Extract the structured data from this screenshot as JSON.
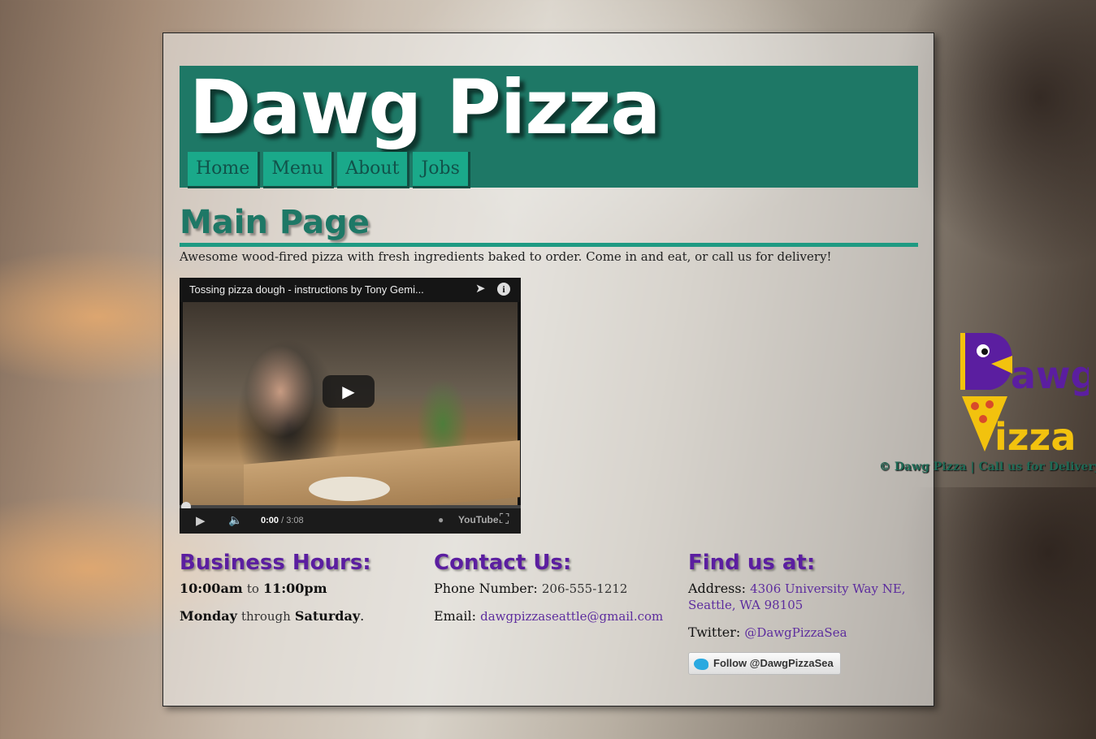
{
  "site": {
    "title": "Dawg Pizza"
  },
  "nav": {
    "items": [
      {
        "label": "Home"
      },
      {
        "label": "Menu"
      },
      {
        "label": "About"
      },
      {
        "label": "Jobs"
      }
    ]
  },
  "main": {
    "heading": "Main Page",
    "intro": "Awesome wood-fired pizza with fresh ingredients baked to order. Come in and eat, or call us for delivery!"
  },
  "video": {
    "title": "Tossing pizza dough - instructions by Tony Gemi...",
    "current_time": "0:00",
    "duration": "/ 3:08",
    "provider": "YouTube"
  },
  "hours": {
    "heading": "Business Hours:",
    "open": "10:00am",
    "to": "to",
    "close": "11:00pm",
    "day_start": "Monday",
    "through": "through",
    "day_end": "Saturday",
    "period": "."
  },
  "contact": {
    "heading": "Contact Us:",
    "phone_label": "Phone Number:",
    "phone": "206-555-1212",
    "email_label": "Email:",
    "email": "dawgpizzaseattle@gmail.com"
  },
  "find": {
    "heading": "Find us at:",
    "address_label": "Address:",
    "address_line1": "4306 University Way NE,",
    "address_line2": "Seattle, WA 98105",
    "twitter_label": "Twitter:",
    "twitter_handle": "@DawgPizzaSea",
    "follow_button": "Follow @DawgPizzaSea"
  },
  "logo": {
    "word1": "awg",
    "word2": "izza"
  },
  "footer": {
    "copyright": "© Dawg Pizza | Call us for Delivery"
  },
  "colors": {
    "header": "#1e7866",
    "nav": "#1aa98a",
    "accent_purple": "#5b1ea0",
    "logo_yellow": "#f2c20e"
  }
}
